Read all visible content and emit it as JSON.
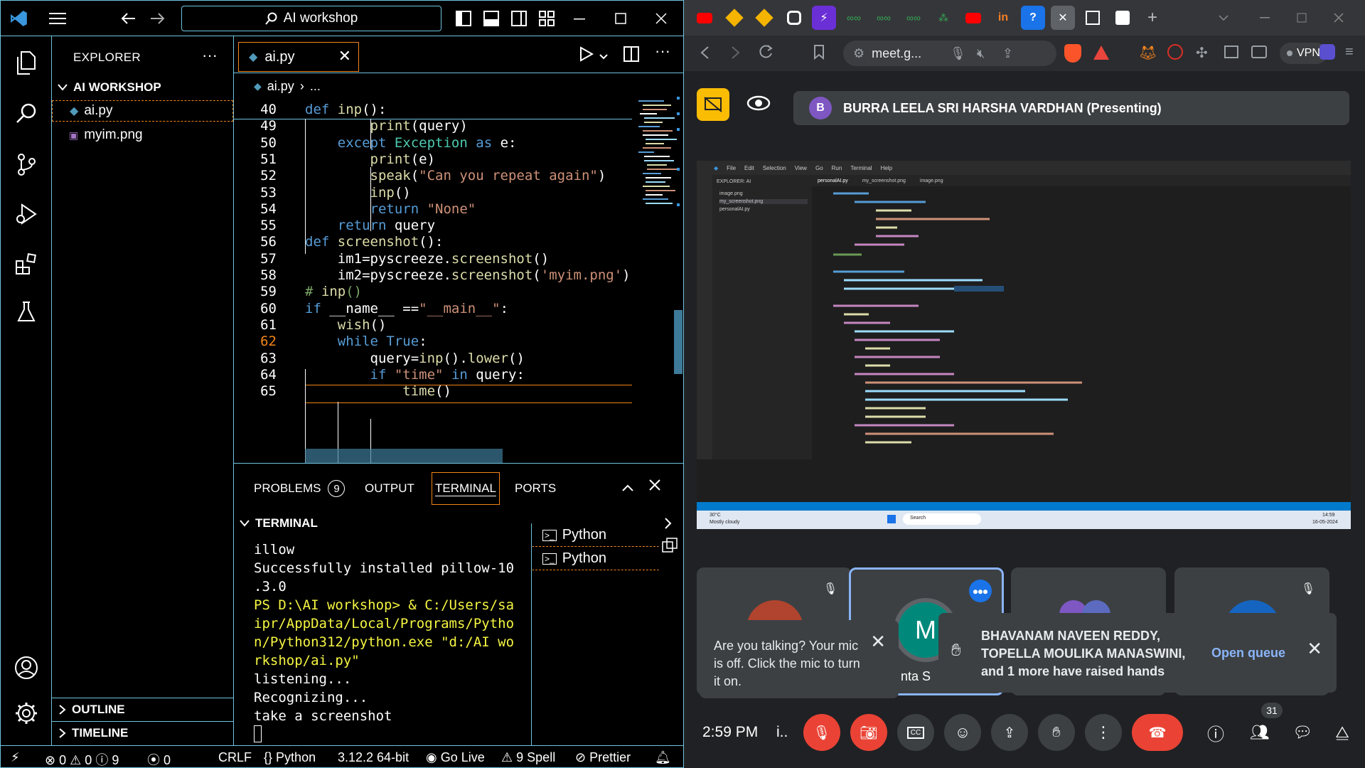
{
  "vscode": {
    "search": "AI workshop",
    "explorer": {
      "header": "EXPLORER",
      "root": "AI WORKSHOP",
      "files": [
        "ai.py",
        "myim.png"
      ],
      "sections": [
        "OUTLINE",
        "TIMELINE"
      ]
    },
    "tab": "ai.py",
    "breadcrumb": [
      "ai.py",
      "..."
    ],
    "code": [
      {
        "num": "40",
        "text": "def inp():"
      },
      {
        "num": "49",
        "text": "        print(query)"
      },
      {
        "num": "50",
        "text": "    except Exception as e:"
      },
      {
        "num": "51",
        "text": "        print(e)"
      },
      {
        "num": "52",
        "text": "        speak(\"Can you repeat again\")"
      },
      {
        "num": "53",
        "text": "        inp()"
      },
      {
        "num": "54",
        "text": "        return \"None\""
      },
      {
        "num": "55",
        "text": "    return query"
      },
      {
        "num": "56",
        "text": "def screenshot():"
      },
      {
        "num": "57",
        "text": "    im1=pyscreeze.screenshot()"
      },
      {
        "num": "58",
        "text": "    im2=pyscreeze.screenshot('myim.png')"
      },
      {
        "num": "59",
        "text": "# inp()"
      },
      {
        "num": "60",
        "text": "if __name__ ==\"__main__\":"
      },
      {
        "num": "61",
        "text": "    wish()"
      },
      {
        "num": "62",
        "text": "    while True:"
      },
      {
        "num": "63",
        "text": "        query=inp().lower()"
      },
      {
        "num": "64",
        "text": "        if \"time\" in query:"
      },
      {
        "num": "65",
        "text": "            time()"
      }
    ],
    "panel": {
      "tabs": [
        "PROBLEMS",
        "OUTPUT",
        "TERMINAL",
        "PORTS"
      ],
      "problems_count": "9",
      "terminal_header": "TERMINAL",
      "terminal_lines": [
        "illow",
        "Successfully installed pillow-10",
        ".3.0",
        "PS D:\\AI workshop> & C:/Users/sa",
        "ipr/AppData/Local/Programs/Pytho",
        "n/Python312/python.exe \"d:/AI wo",
        "rkshop/ai.py\"",
        "listening...",
        "Recognizing...",
        "take a screenshot"
      ],
      "terminals": [
        "Python",
        "Python"
      ]
    },
    "status": {
      "errors": "0",
      "warnings": "0",
      "info": "9",
      "ports": "0",
      "eol": "CRLF",
      "language": "Python",
      "interpreter": "3.12.2 64-bit",
      "live": "Go Live",
      "spell": "9 Spell",
      "prettier": "Prettier"
    }
  },
  "browser": {
    "url": "meet.g...",
    "vpn": "VPN",
    "presenter": "BURRA LEELA SRI HARSHA VARDHAN (Presenting)",
    "presenter_initial": "B",
    "shared_screen": {
      "tab1": "personalAI.py",
      "tab2": "my_screenshot.png",
      "tab3": "image.png",
      "files": [
        "image.png",
        "my_screenshot.png",
        "personalAI.py"
      ],
      "weather": "30°C",
      "weather_desc": "Mostly cloudy",
      "clock": "14:59",
      "date": "16-05-2024",
      "search": "Search"
    },
    "tile_initial": "M",
    "tile_name_fragment": "nta S",
    "mic_toast": "Are you talking? Your mic is off. Click the mic to turn it on.",
    "hands_toast": "BHAVANAM NAVEEN REDDY, TOPELLA MOULIKA MANASWINI, and 1 more have raised hands",
    "open_queue": "Open queue",
    "time": "2:59 PM",
    "meeting_code": "i..",
    "participants_count": "31",
    "accent": "#8ab4f8",
    "end_call_color": "#ea4335"
  }
}
